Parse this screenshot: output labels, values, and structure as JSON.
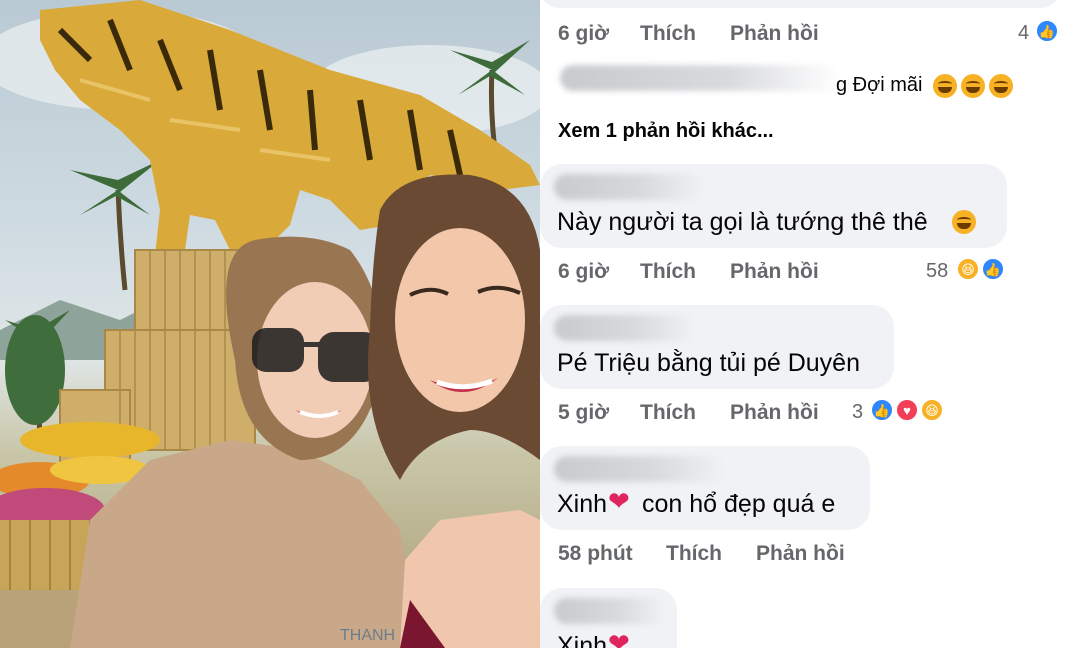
{
  "photo": {
    "shirt_brand": "THANH"
  },
  "comments": [
    {
      "time": "6 giờ",
      "like": "Thích",
      "reply": "Phản hồi",
      "reaction_count": "4",
      "reactions": [
        "like-icon"
      ]
    },
    {
      "text_tail": "g Đợi mãi",
      "more": "Xem 1 phản hồi khác..."
    },
    {
      "text": "Này người ta gọi là tướng thê thê",
      "time": "6 giờ",
      "like": "Thích",
      "reply": "Phản hồi",
      "reaction_count": "58",
      "reactions": [
        "haha-icon",
        "like-icon"
      ]
    },
    {
      "text": "Pé Triệu bằng tủi pé Duyên",
      "time": "5 giờ",
      "like": "Thích",
      "reply": "Phản hồi",
      "reaction_count": "3",
      "reactions": [
        "like-icon",
        "love-icon",
        "haha-icon"
      ]
    },
    {
      "text_a": "Xinh",
      "text_b": "con hổ đẹp quá e",
      "time": "58 phút",
      "like": "Thích",
      "reply": "Phản hồi"
    },
    {
      "text": "Xinh"
    }
  ],
  "colors": {
    "bubble": "#f0f2f5",
    "meta": "#65676b",
    "like": "#2d88ff",
    "love": "#f33e58",
    "haha": "#f7b125"
  }
}
